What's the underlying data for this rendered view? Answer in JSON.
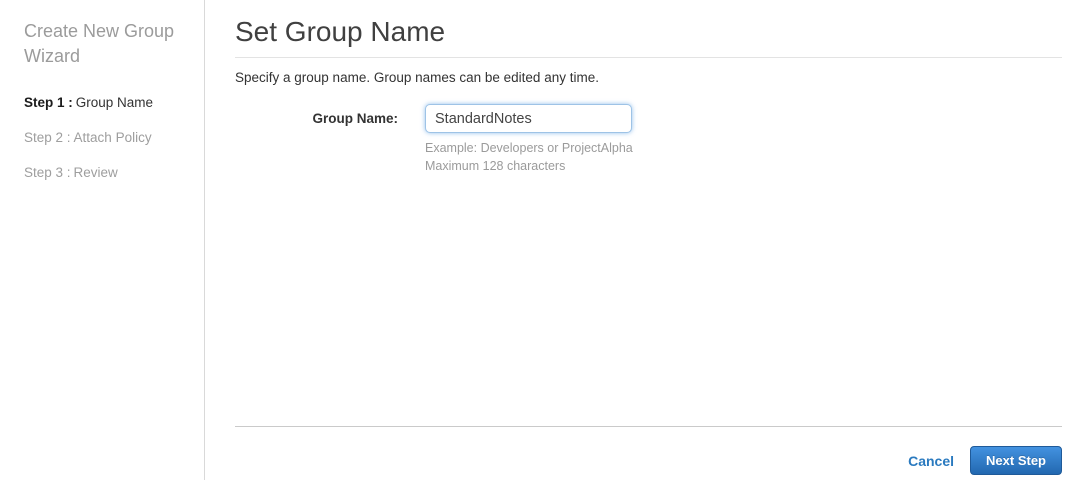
{
  "sidebar": {
    "title": "Create New Group Wizard",
    "steps": [
      {
        "prefix": "Step 1 :",
        "label": "Group Name"
      },
      {
        "prefix": "Step 2 :",
        "label": "Attach Policy"
      },
      {
        "prefix": "Step 3 :",
        "label": "Review"
      }
    ]
  },
  "main": {
    "title": "Set Group Name",
    "description": "Specify a group name. Group names can be edited any time.",
    "form": {
      "group_name_label": "Group Name:",
      "group_name_value": "StandardNotes",
      "hint_example": "Example: Developers or ProjectAlpha",
      "hint_max": "Maximum 128 characters"
    },
    "footer": {
      "cancel_label": "Cancel",
      "next_label": "Next Step"
    }
  },
  "colors": {
    "link_blue": "#2a7abf",
    "button_gradient_top": "#4392e0",
    "button_gradient_bottom": "#2268b0",
    "active_step_text": "#333333",
    "inactive_step_text": "#9e9e9e"
  }
}
